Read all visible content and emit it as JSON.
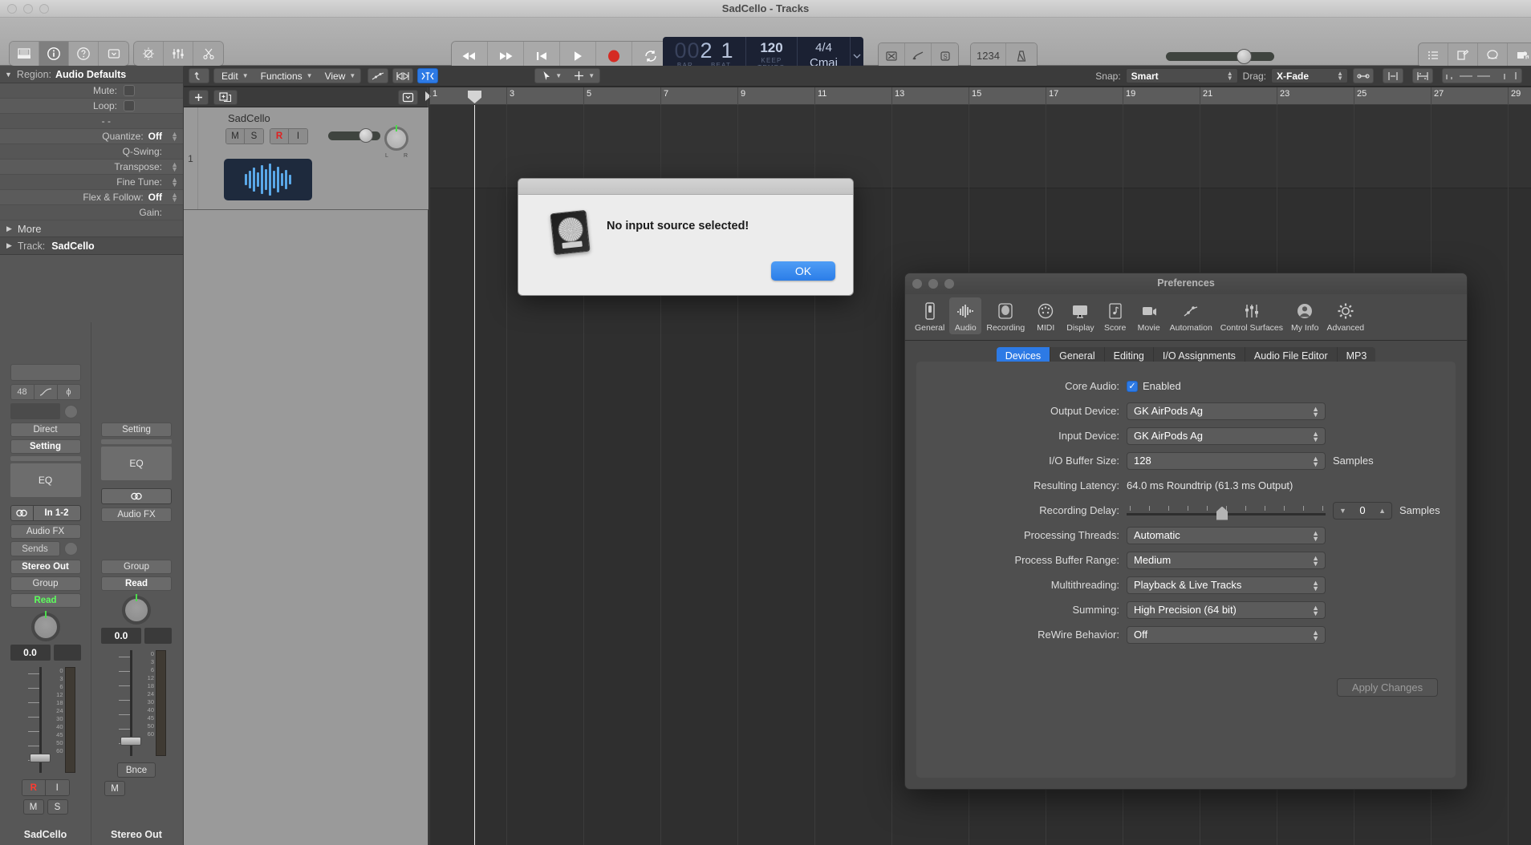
{
  "window": {
    "title": "SadCello - Tracks"
  },
  "toolbar": {
    "left_icons": [
      "library-icon",
      "inspector-icon",
      "quick-help-icon",
      "toolbar-disclosure-icon"
    ],
    "tool_icons": [
      "smart-controls-icon",
      "mixer-icon",
      "editors-scissors-icon"
    ],
    "transport": [
      "rewind-icon",
      "forward-icon",
      "go-to-start-icon",
      "play-icon",
      "record-icon",
      "cycle-icon"
    ],
    "lcd": {
      "position_dim": "00",
      "position_bar": "2",
      "position_beat": "1",
      "bar_label": "BAR",
      "beat_label": "BEAT",
      "tempo_value": "120",
      "tempo_keep": "KEEP",
      "tempo_label": "TEMPO",
      "signature": "4/4",
      "key": "Cmaj",
      "chevron": "chevron-down-icon"
    },
    "mode_icons": [
      "low-latency-icon",
      "tuner-icon",
      "solo-icon"
    ],
    "count_in": "1234",
    "metronome_icon": "metronome-icon",
    "right_icons": [
      "list-editors-icon",
      "notepad-icon",
      "loops-browser-icon",
      "media-browser-icon"
    ]
  },
  "inspector": {
    "region_header": {
      "label": "Region:",
      "value": "Audio Defaults"
    },
    "rows": [
      {
        "label": "Mute:",
        "value": "",
        "checkbox": true,
        "stepper": false
      },
      {
        "label": "Loop:",
        "value": "",
        "checkbox": true,
        "stepper": false
      },
      {
        "label": "-  -",
        "value": "",
        "checkbox": false,
        "stepper": false
      },
      {
        "label": "Quantize:",
        "value": "Off",
        "checkbox": false,
        "stepper": true
      },
      {
        "label": "Q-Swing:",
        "value": "",
        "checkbox": false,
        "stepper": false
      },
      {
        "label": "Transpose:",
        "value": "",
        "checkbox": false,
        "stepper": true
      },
      {
        "label": "Fine Tune:",
        "value": "",
        "checkbox": false,
        "stepper": true
      },
      {
        "label": "Flex & Follow:",
        "value": "Off",
        "checkbox": false,
        "stepper": true
      },
      {
        "label": "Gain:",
        "value": "",
        "checkbox": false,
        "stepper": false
      }
    ],
    "more_label": "More",
    "track_header": {
      "label": "Track:",
      "value": "SadCello"
    }
  },
  "channel_strips": [
    {
      "name": "SadCello",
      "input_format": "48",
      "direct": "Direct",
      "setting": "Setting",
      "eq": "EQ",
      "input": "In 1-2",
      "audio_fx": "Audio FX",
      "sends": "Sends",
      "output": "Stereo Out",
      "group": "Group",
      "automation": "Read",
      "volume": "0.0",
      "record": "R",
      "input_monitor": "I",
      "mute": "M",
      "solo": "S",
      "meter_labels": [
        "0",
        "3",
        "6",
        "12",
        "18",
        "24",
        "30",
        "40",
        "45",
        "50",
        "60"
      ]
    },
    {
      "name": "Stereo Out",
      "setting": "Setting",
      "eq": "EQ",
      "audio_fx": "Audio FX",
      "group": "Group",
      "automation": "Read",
      "volume": "0.0",
      "bounce": "Bnce",
      "mute": "M",
      "meter_labels": [
        "0",
        "3",
        "6",
        "12",
        "18",
        "24",
        "30",
        "40",
        "45",
        "50",
        "60"
      ]
    }
  ],
  "arrange": {
    "toolbar": {
      "undo_icon": "undo-icon",
      "menus": [
        "Edit",
        "Functions",
        "View"
      ],
      "automation_icon": "automation-icon",
      "flex_icon": "flex-icon",
      "snap_mode_icon": "snap-icon",
      "pointer_tool_icon": "pointer-tool-icon",
      "marquee_tool_icon": "marquee-tool-icon",
      "snap_label": "Snap:",
      "snap_value": "Smart",
      "drag_label": "Drag:",
      "drag_value": "X-Fade",
      "right_icons": [
        "link-icon",
        "flex-time-icon",
        "fade-icon",
        "zoom-slider-icon"
      ]
    },
    "track_controls": {
      "add_track_icon": "add-track-icon",
      "duplicate_track_icon": "duplicate-track-icon",
      "disclosure_icon": "track-disclosure-icon"
    },
    "track": {
      "number": "1",
      "name": "SadCello",
      "mute": "M",
      "solo": "S",
      "record": "R",
      "input": "I",
      "pan_left": "L",
      "pan_right": "R"
    },
    "ruler_marks": [
      "1",
      "3",
      "5",
      "7",
      "9",
      "11",
      "13",
      "15",
      "17",
      "19",
      "21",
      "23",
      "25",
      "27",
      "29"
    ]
  },
  "alert": {
    "message": "No input source selected!",
    "ok_label": "OK",
    "icon": "logic-disc-icon"
  },
  "preferences": {
    "title": "Preferences",
    "categories": [
      {
        "label": "General",
        "icon": "general-icon",
        "selected": false
      },
      {
        "label": "Audio",
        "icon": "audio-waveform-icon",
        "selected": true
      },
      {
        "label": "Recording",
        "icon": "recording-icon",
        "selected": false
      },
      {
        "label": "MIDI",
        "icon": "midi-icon",
        "selected": false
      },
      {
        "label": "Display",
        "icon": "display-icon",
        "selected": false
      },
      {
        "label": "Score",
        "icon": "score-icon",
        "selected": false
      },
      {
        "label": "Movie",
        "icon": "movie-icon",
        "selected": false
      },
      {
        "label": "Automation",
        "icon": "automation-icon",
        "selected": false
      },
      {
        "label": "Control Surfaces",
        "icon": "control-surfaces-icon",
        "selected": false
      },
      {
        "label": "My Info",
        "icon": "my-info-icon",
        "selected": false
      },
      {
        "label": "Advanced",
        "icon": "advanced-gear-icon",
        "selected": false
      }
    ],
    "tabs": [
      {
        "label": "Devices",
        "selected": true
      },
      {
        "label": "General",
        "selected": false
      },
      {
        "label": "Editing",
        "selected": false
      },
      {
        "label": "I/O Assignments",
        "selected": false
      },
      {
        "label": "Audio File Editor",
        "selected": false
      },
      {
        "label": "MP3",
        "selected": false
      }
    ],
    "fields": {
      "core_audio_label": "Core Audio:",
      "core_audio_value": "Enabled",
      "core_audio_checked": true,
      "output_device_label": "Output Device:",
      "output_device_value": "GK AirPods Ag",
      "input_device_label": "Input Device:",
      "input_device_value": "GK AirPods Ag",
      "buffer_label": "I/O Buffer Size:",
      "buffer_value": "128",
      "buffer_unit": "Samples",
      "latency_label": "Resulting Latency:",
      "latency_value": "64.0 ms Roundtrip (61.3 ms Output)",
      "rec_delay_label": "Recording Delay:",
      "rec_delay_value": "0",
      "rec_delay_unit": "Samples",
      "threads_label": "Processing Threads:",
      "threads_value": "Automatic",
      "buffer_range_label": "Process Buffer Range:",
      "buffer_range_value": "Medium",
      "multithreading_label": "Multithreading:",
      "multithreading_value": "Playback & Live Tracks",
      "summing_label": "Summing:",
      "summing_value": "High Precision (64 bit)",
      "rewire_label": "ReWire Behavior:",
      "rewire_value": "Off",
      "apply_label": "Apply Changes"
    }
  },
  "colors": {
    "accent_blue": "#2d7ae5",
    "record_red": "#ff3b30",
    "automation_green": "#5dff5d",
    "lcd_bg": "#1b2133"
  }
}
